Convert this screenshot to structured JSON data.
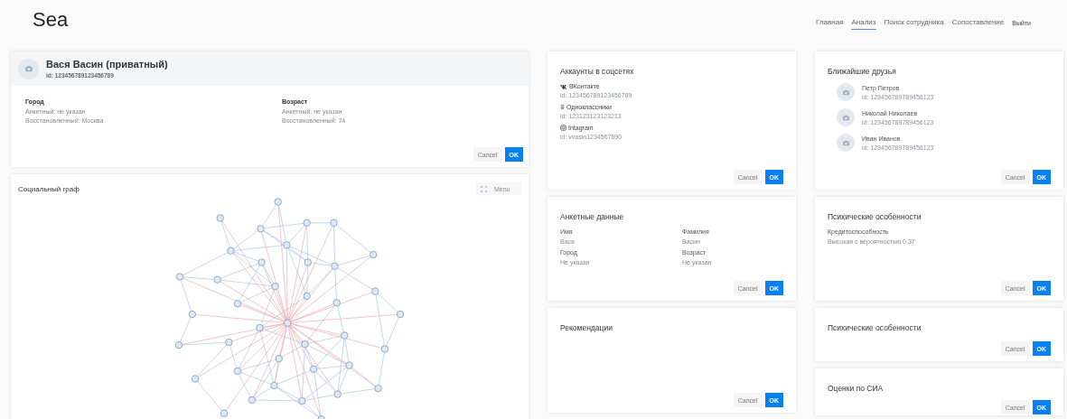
{
  "header": {
    "logo": "Sea",
    "nav": [
      {
        "label": "Главная",
        "selected": false
      },
      {
        "label": "Анализ",
        "selected": true
      },
      {
        "label": "Поиск сотрудника",
        "selected": false
      },
      {
        "label": "Сопоставление",
        "selected": false
      }
    ],
    "logout": "Выйти"
  },
  "profile": {
    "name": "Вася Васин (приватный)",
    "id": "id: 123456789123456789",
    "fields": [
      {
        "title": "Город",
        "lines": [
          "Анкетный: не указан",
          "Восстановленный: Москва"
        ]
      },
      {
        "title": "Возраст",
        "lines": [
          "Анкетный: не указан",
          "Восстановленный: 74"
        ]
      }
    ],
    "cancel": "Cancel",
    "ok": "OK"
  },
  "graph": {
    "title": "Социальный граф",
    "menu": "Menu"
  },
  "accounts": {
    "title": "Аккаунты в соцсетях",
    "items": [
      {
        "kind": "vk",
        "name": "ВКонтакте",
        "id": "id: 123456789123456789"
      },
      {
        "kind": "ok",
        "name": "Одноклассники",
        "id": "id: 123123123123213"
      },
      {
        "kind": "instagram",
        "name": "Intagram",
        "id": "id: vvasin1234567890"
      }
    ],
    "cancel": "Cancel",
    "ok": "OK"
  },
  "friends": {
    "title": "Ближайшие друзья",
    "items": [
      {
        "name": "Петр Петров",
        "id": "id: 123456789789456123"
      },
      {
        "name": "Николай Николаев",
        "id": "id: 123456789789456123"
      },
      {
        "name": "Иван Иванов",
        "id": "id: 123456789789456123"
      }
    ],
    "cancel": "Cancel",
    "ok": "OK"
  },
  "questionnaire": {
    "title": "Анкетные данные",
    "fields": [
      {
        "label": "Имя",
        "value": "Вася"
      },
      {
        "label": "Фамилия",
        "value": "Васин"
      },
      {
        "label": "Город",
        "value": "Не указан"
      },
      {
        "label": "Возраст",
        "value": "Не указан"
      }
    ],
    "cancel": "Cancel",
    "ok": "OK"
  },
  "psych": {
    "title": "Психические особенности",
    "items": [
      {
        "label": "Кредитоспособность",
        "value": "Высокая с вероятностью 0.37"
      }
    ],
    "cancel": "Cancel",
    "ok": "OK"
  },
  "recommendations": {
    "title": "Рекомендации",
    "cancel": "Cancel",
    "ok": "OK"
  },
  "psych2": {
    "title": "Психические особенности",
    "cancel": "Cancel",
    "ok": "OK"
  },
  "sia": {
    "title": "Оценки по СИА",
    "cancel": "Cancel",
    "ok": "OK"
  }
}
